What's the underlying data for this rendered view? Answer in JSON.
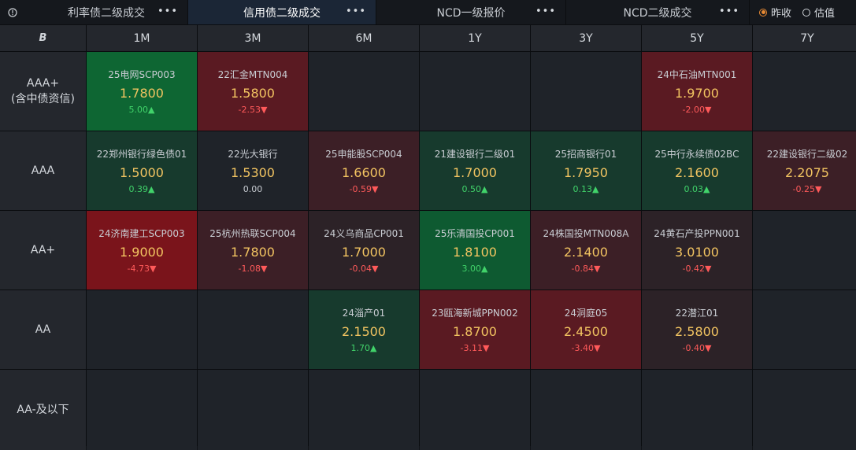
{
  "tabs": [
    {
      "label": "利率债二级成交",
      "more": "•••"
    },
    {
      "label": "信用债二级成交",
      "more": "•••"
    },
    {
      "label": "NCD一级报价",
      "more": "•••"
    },
    {
      "label": "NCD二级成交",
      "more": "•••"
    }
  ],
  "radios": {
    "option1": "昨收",
    "option2": "估值"
  },
  "header": {
    "corner_icon": "B",
    "columns": [
      "1M",
      "3M",
      "6M",
      "1Y",
      "3Y",
      "5Y",
      "7Y"
    ]
  },
  "rows": [
    {
      "label": "AAA+\n(含中债资信)",
      "cells": [
        {
          "name": "25电网SCP003",
          "rate": "1.7800",
          "chg": "5.00▲"
        },
        {
          "name": "22汇金MTN004",
          "rate": "1.5800",
          "chg": "-2.53▼"
        },
        null,
        null,
        null,
        {
          "name": "24中石油MTN001",
          "rate": "1.9700",
          "chg": "-2.00▼"
        },
        null
      ]
    },
    {
      "label": "AAA",
      "cells": [
        {
          "name": "22郑州银行绿色债01",
          "rate": "1.5000",
          "chg": "0.39▲"
        },
        {
          "name": "22光大银行",
          "rate": "1.5300",
          "chg": "0.00"
        },
        {
          "name": "25申能股SCP004",
          "rate": "1.6600",
          "chg": "-0.59▼"
        },
        {
          "name": "21建设银行二级01",
          "rate": "1.7000",
          "chg": "0.50▲"
        },
        {
          "name": "25招商银行01",
          "rate": "1.7950",
          "chg": "0.13▲"
        },
        {
          "name": "25中行永续债02BC",
          "rate": "2.1600",
          "chg": "0.03▲"
        },
        {
          "name": "22建设银行二级02",
          "rate": "2.2075",
          "chg": "-0.25▼"
        }
      ]
    },
    {
      "label": "AA+",
      "cells": [
        {
          "name": "24济南建工SCP003",
          "rate": "1.9000",
          "chg": "-4.73▼"
        },
        {
          "name": "25杭州热联SCP004",
          "rate": "1.7800",
          "chg": "-1.08▼"
        },
        {
          "name": "24义乌商品CP001",
          "rate": "1.7000",
          "chg": "-0.04▼"
        },
        {
          "name": "25乐清国投CP001",
          "rate": "1.8100",
          "chg": "3.00▲"
        },
        {
          "name": "24株国投MTN008A",
          "rate": "2.1400",
          "chg": "-0.84▼"
        },
        {
          "name": "24黄石产投PPN001",
          "rate": "3.0100",
          "chg": "-0.42▼"
        },
        null
      ]
    },
    {
      "label": "AA",
      "cells": [
        null,
        null,
        {
          "name": "24淄产01",
          "rate": "2.1500",
          "chg": "1.70▲"
        },
        {
          "name": "23瓯海新城PPN002",
          "rate": "1.8700",
          "chg": "-3.11▼"
        },
        {
          "name": "24洞庭05",
          "rate": "2.4500",
          "chg": "-3.40▼"
        },
        {
          "name": "22潜江01",
          "rate": "2.5800",
          "chg": "-0.40▼"
        },
        null
      ]
    },
    {
      "label": "AA-及以下",
      "cells": [
        null,
        null,
        null,
        null,
        null,
        null,
        null
      ]
    }
  ],
  "colors": {
    "accent": "#e88a34",
    "rate": "#f2c461",
    "up": "#41d36a",
    "down": "#ff5a5a"
  }
}
